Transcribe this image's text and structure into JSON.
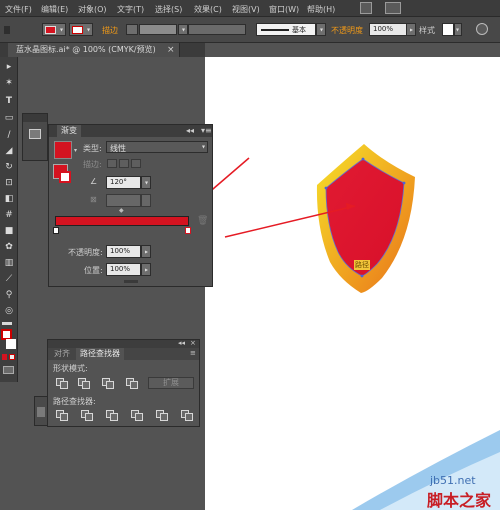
{
  "menu": {
    "items": [
      "文件(F)",
      "编辑(E)",
      "对象(O)",
      "文字(T)",
      "选择(S)",
      "效果(C)",
      "视图(V)",
      "窗口(W)",
      "帮助(H)"
    ]
  },
  "control_bar": {
    "stroke_label": "描边",
    "basic_label": "基本",
    "opacity_label": "不透明度",
    "opacity_value": "100%",
    "style_label": "样式"
  },
  "document": {
    "tab_title": "蓝水晶图标.ai* @ 100% (CMYK/预览)",
    "close_glyph": "×"
  },
  "gradient_panel": {
    "title": "渐变",
    "type_label": "类型:",
    "type_value": "线性",
    "stroke_label": "描边:",
    "angle_value": "120°",
    "opacity_label": "不透明度:",
    "opacity_value": "100%",
    "location_label": "位置:",
    "location_value": "100%"
  },
  "pathfinder_panel": {
    "tabs": [
      "对齐",
      "路径查找器"
    ],
    "shape_modes_label": "形状模式:",
    "pathfinders_label": "路径查找器:",
    "expand_label": "扩展"
  },
  "canvas": {
    "path_label": "路径"
  },
  "watermark": {
    "url": "jb51.net",
    "text": "脚本之家"
  },
  "colors": {
    "gradient_red": "#d41320",
    "shield_red": "#e01a2e",
    "shield_rim_yellow": "#f5e12a",
    "shield_rim_orange": "#ec7a1a",
    "arrow_red": "#e51b24"
  }
}
